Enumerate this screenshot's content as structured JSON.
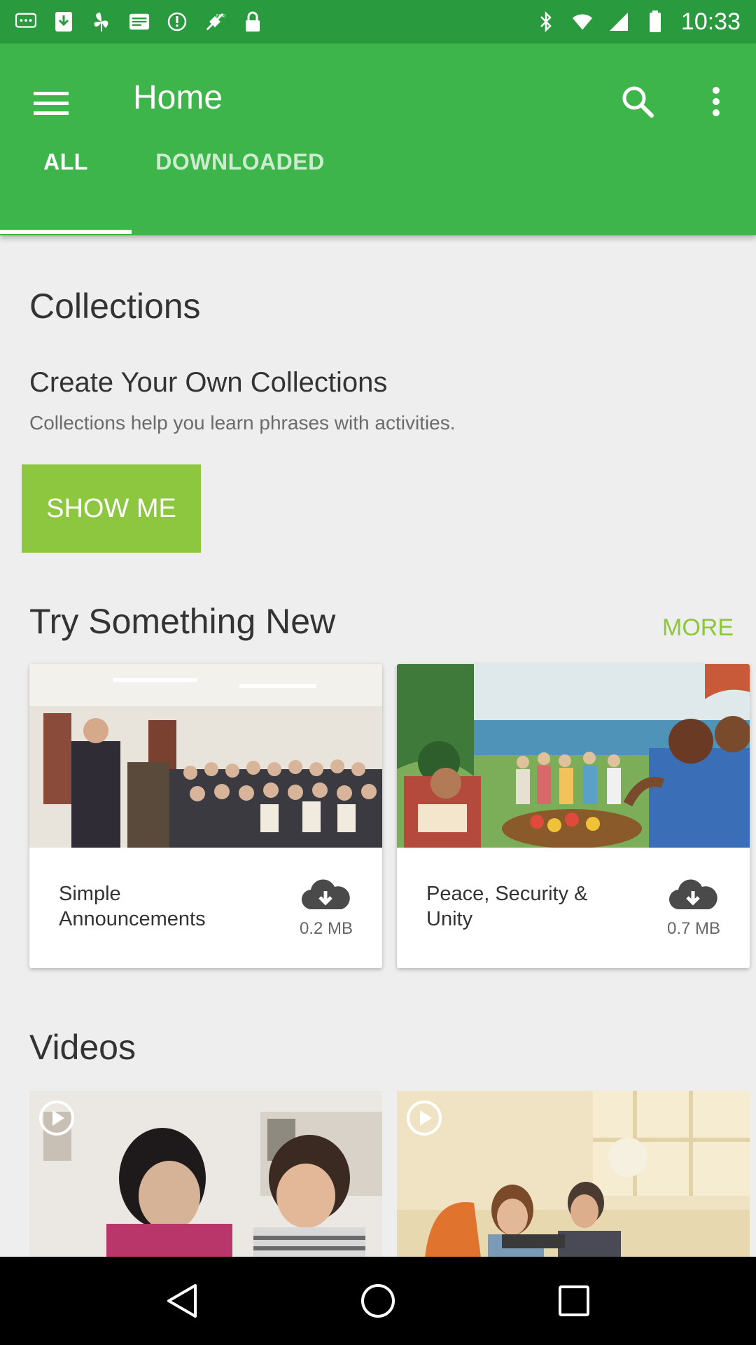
{
  "status_bar": {
    "time": "10:33",
    "left_icons": [
      "chat-bubble-icon",
      "download-icon",
      "fan-icon",
      "inbox-icon",
      "warning-icon",
      "fake-gps-icon",
      "lock-icon"
    ],
    "right_icons": [
      "bluetooth-icon",
      "wifi-icon",
      "signal-icon",
      "battery-icon"
    ]
  },
  "app_bar": {
    "title": "Home",
    "menu_icon": "hamburger-menu-icon",
    "search_icon": "search-icon",
    "more_icon": "more-vert-icon",
    "color": "#3db54a"
  },
  "tabs": [
    {
      "label": "ALL",
      "selected": true
    },
    {
      "label": "DOWNLOADED",
      "selected": false
    }
  ],
  "collections": {
    "title": "Collections",
    "create_title": "Create Your Own Collections",
    "description": "Collections help you learn phrases with activities.",
    "button_label": "SHOW ME",
    "button_color": "#8dc63f"
  },
  "try_something_new": {
    "title": "Try Something New",
    "more_label": "MORE",
    "cards": [
      {
        "title": "Simple Announcements",
        "size": "0.2 MB"
      },
      {
        "title": "Peace, Security & Unity",
        "size": "0.7 MB"
      }
    ]
  },
  "videos": {
    "title": "Videos"
  },
  "nav_bar": {
    "icons": [
      "back-icon",
      "home-icon",
      "recents-icon"
    ]
  }
}
